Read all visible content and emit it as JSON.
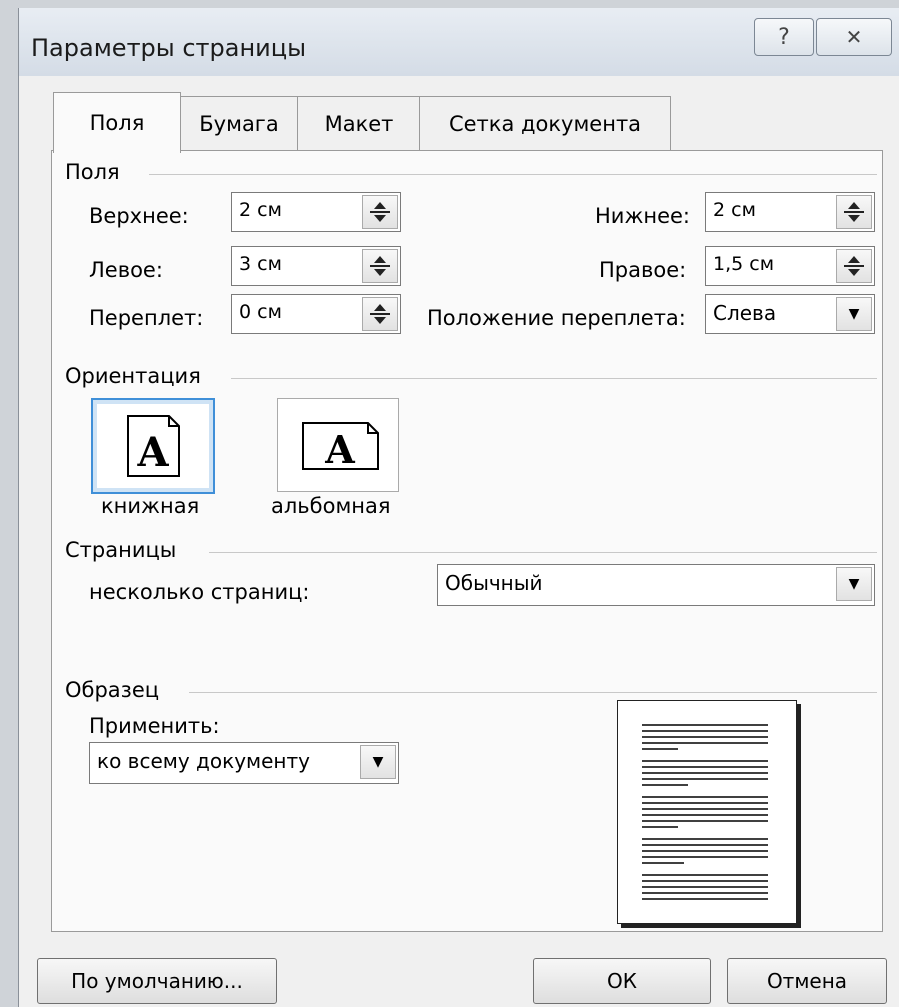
{
  "window": {
    "title": "Параметры страницы",
    "help_symbol": "?",
    "close_symbol": "✕"
  },
  "tabs": [
    {
      "label": "Поля",
      "active": true
    },
    {
      "label": "Бумага",
      "active": false
    },
    {
      "label": "Макет",
      "active": false
    },
    {
      "label": "Сетка документа",
      "active": false
    }
  ],
  "margins": {
    "group_label": "Поля",
    "top_label": "Верхнее:",
    "top_value": "2 см",
    "bottom_label": "Нижнее:",
    "bottom_value": "2 см",
    "left_label": "Левое:",
    "left_value": "3 см",
    "right_label": "Правое:",
    "right_value": "1,5 см",
    "gutter_label": "Переплет:",
    "gutter_value": "0 см",
    "gutter_pos_label": "Положение переплета:",
    "gutter_pos_value": "Слева"
  },
  "orientation": {
    "group_label": "Ориентация",
    "portrait_label": "книжная",
    "landscape_label": "альбомная",
    "icon_letter": "A",
    "selected": "portrait"
  },
  "pages": {
    "group_label": "Страницы",
    "multiple_label": "несколько страниц:",
    "multiple_value": "Обычный"
  },
  "preview": {
    "group_label": "Образец",
    "apply_label": "Применить:",
    "apply_value": "ко всему документу"
  },
  "buttons": {
    "default_label": "По умолчанию...",
    "ok_label": "ОК",
    "cancel_label": "Отмена"
  }
}
